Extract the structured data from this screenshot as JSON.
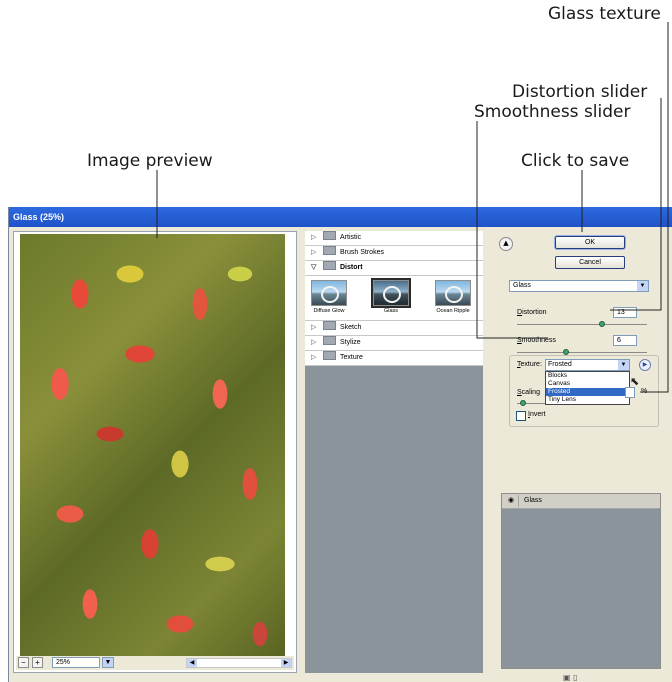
{
  "callouts": {
    "glass_texture": "Glass texture",
    "distortion_slider": "Distortion slider",
    "smoothness_slider": "Smoothness slider",
    "click_to_save": "Click to save",
    "image_preview": "Image preview"
  },
  "window": {
    "title": "Glass (25%)"
  },
  "preview": {
    "zoom_value": "25%",
    "zoom_out_icon": "minus",
    "zoom_in_icon": "plus"
  },
  "filter_browser": {
    "categories": [
      {
        "label": "Artistic",
        "expanded": false
      },
      {
        "label": "Brush Strokes",
        "expanded": false
      },
      {
        "label": "Distort",
        "expanded": true
      },
      {
        "label": "Sketch",
        "expanded": false
      },
      {
        "label": "Stylize",
        "expanded": false
      },
      {
        "label": "Texture",
        "expanded": false
      }
    ],
    "thumbnails": [
      {
        "label": "Diffuse Glow",
        "selected": false
      },
      {
        "label": "Glass",
        "selected": true
      },
      {
        "label": "Ocean Ripple",
        "selected": false
      }
    ]
  },
  "settings": {
    "ok_label": "OK",
    "cancel_label": "Cancel",
    "filter_select": "Glass",
    "distortion": {
      "label_ul": "D",
      "label_rest": "istortion",
      "value": "13",
      "level": 0.65
    },
    "smoothness": {
      "label_ul": "S",
      "label_rest": "moothness",
      "value": "6",
      "level": 0.38
    },
    "texture": {
      "label_ul": "T",
      "label_rest": "exture:",
      "value": "Frosted",
      "options": [
        "Blocks",
        "Canvas",
        "Frosted",
        "Tiny Lens"
      ],
      "highlighted": "Frosted"
    },
    "scaling": {
      "label_ul": "S",
      "label_rest": "caling",
      "unit": "%",
      "level": 0.2
    },
    "invert": {
      "label_ul": "I",
      "label_rest": "nvert",
      "checked": false
    }
  },
  "layers": {
    "name": "Glass"
  },
  "colors": {
    "titlebar": "#2d6ae0",
    "slider_knob": "#3fa36a",
    "highlight": "#316ac5"
  }
}
